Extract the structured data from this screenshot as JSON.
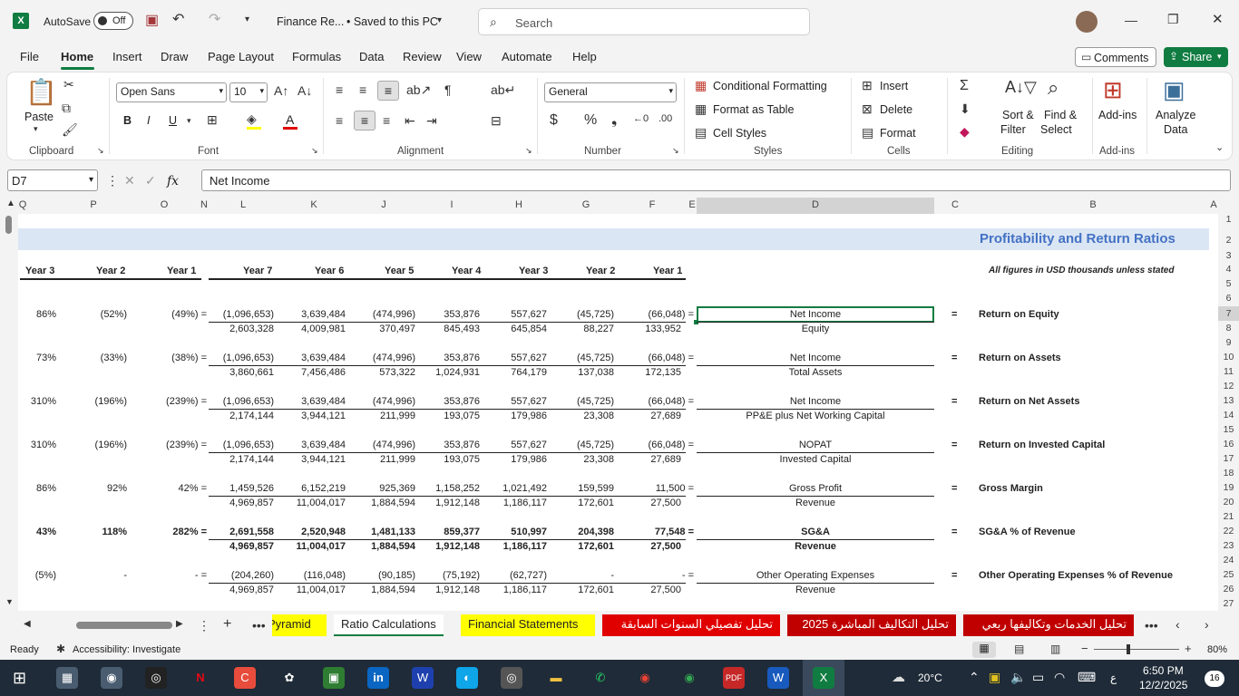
{
  "titlebar": {
    "autosave_label": "AutoSave",
    "autosave_state": "Off",
    "filename": "Finance Re...",
    "saved_status": "• Saved to this PC",
    "search_placeholder": "Search"
  },
  "menu": [
    "File",
    "Home",
    "Insert",
    "Draw",
    "Page Layout",
    "Formulas",
    "Data",
    "Review",
    "View",
    "Automate",
    "Help"
  ],
  "menu_right": {
    "comments": "Comments",
    "share": "Share"
  },
  "ribbon": {
    "clipboard": {
      "paste": "Paste",
      "label": "Clipboard"
    },
    "font": {
      "family": "Open Sans",
      "size": "10",
      "label": "Font",
      "bold": "B",
      "italic": "I",
      "underline": "U"
    },
    "alignment": {
      "label": "Alignment"
    },
    "number": {
      "format": "General",
      "label": "Number"
    },
    "styles": {
      "cond": "Conditional Formatting",
      "table": "Format as Table",
      "cell": "Cell Styles",
      "label": "Styles"
    },
    "cells": {
      "insert": "Insert",
      "delete": "Delete",
      "format": "Format",
      "label": "Cells"
    },
    "editing": {
      "sort": "Sort &",
      "sort2": "Filter",
      "find": "Find &",
      "find2": "Select",
      "label": "Editing"
    },
    "addins": {
      "btn": "Add-ins",
      "label": "Add-ins"
    },
    "analyze": {
      "btn": "Analyze",
      "btn2": "Data"
    }
  },
  "formula_bar": {
    "name_box": "D7",
    "fx": "fx",
    "content": "Net Income"
  },
  "columns": [
    "Q",
    "P",
    "O",
    "N",
    "L",
    "K",
    "J",
    "I",
    "H",
    "G",
    "F",
    "E",
    "D",
    "C",
    "B",
    "A"
  ],
  "rows": [
    "1",
    "2",
    "3",
    "4",
    "5",
    "6",
    "7",
    "8",
    "9",
    "10",
    "11",
    "12",
    "13",
    "14",
    "15",
    "16",
    "17",
    "18",
    "19",
    "20",
    "21",
    "22",
    "23",
    "24",
    "25",
    "26",
    "27"
  ],
  "sheet": {
    "title": "Profitability and Return Ratios",
    "subtitle": "All figures in USD thousands unless stated",
    "left_years": [
      "Year 3",
      "Year 2",
      "Year 1"
    ],
    "right_years": [
      "Year 7",
      "Year 6",
      "Year 5",
      "Year 4",
      "Year 3",
      "Year 2",
      "Year 1"
    ],
    "blocks": [
      {
        "pct": [
          "86%",
          "(52%)",
          "(49%) ="
        ],
        "num": [
          "(1,096,653)",
          "3,639,484",
          "(474,996)",
          "353,876",
          "557,627",
          "(45,725)",
          "(66,048) ="
        ],
        "den": [
          "2,603,328",
          "4,009,981",
          "370,497",
          "845,493",
          "645,854",
          "88,227",
          "133,952"
        ],
        "top": "Net Income",
        "bottom": "Equity",
        "name": "Return on Equity"
      },
      {
        "pct": [
          "73%",
          "(33%)",
          "(38%) ="
        ],
        "num": [
          "(1,096,653)",
          "3,639,484",
          "(474,996)",
          "353,876",
          "557,627",
          "(45,725)",
          "(66,048) ="
        ],
        "den": [
          "3,860,661",
          "7,456,486",
          "573,322",
          "1,024,931",
          "764,179",
          "137,038",
          "172,135"
        ],
        "top": "Net Income",
        "bottom": "Total Assets",
        "name": "Return on Assets"
      },
      {
        "pct": [
          "310%",
          "(196%)",
          "(239%) ="
        ],
        "num": [
          "(1,096,653)",
          "3,639,484",
          "(474,996)",
          "353,876",
          "557,627",
          "(45,725)",
          "(66,048) ="
        ],
        "den": [
          "2,174,144",
          "3,944,121",
          "211,999",
          "193,075",
          "179,986",
          "23,308",
          "27,689"
        ],
        "top": "Net Income",
        "bottom": "PP&E plus Net Working Capital",
        "name": "Return on Net Assets"
      },
      {
        "pct": [
          "310%",
          "(196%)",
          "(239%) ="
        ],
        "num": [
          "(1,096,653)",
          "3,639,484",
          "(474,996)",
          "353,876",
          "557,627",
          "(45,725)",
          "(66,048) ="
        ],
        "den": [
          "2,174,144",
          "3,944,121",
          "211,999",
          "193,075",
          "179,986",
          "23,308",
          "27,689"
        ],
        "top": "NOPAT",
        "bottom": "Invested Capital",
        "name": "Return on Invested Capital"
      },
      {
        "pct": [
          "86%",
          "92%",
          "42% ="
        ],
        "num": [
          "1,459,526",
          "6,152,219",
          "925,369",
          "1,158,252",
          "1,021,492",
          "159,599",
          "11,500 ="
        ],
        "den": [
          "4,969,857",
          "11,004,017",
          "1,884,594",
          "1,912,148",
          "1,186,117",
          "172,601",
          "27,500"
        ],
        "top": "Gross Profit",
        "bottom": "Revenue",
        "name": "Gross Margin"
      },
      {
        "pct": [
          "43%",
          "118%",
          "282% ="
        ],
        "num": [
          "2,691,558",
          "2,520,948",
          "1,481,133",
          "859,377",
          "510,997",
          "204,398",
          "77,548 ="
        ],
        "den": [
          "4,969,857",
          "11,004,017",
          "1,884,594",
          "1,912,148",
          "1,186,117",
          "172,601",
          "27,500"
        ],
        "top": "SG&A",
        "bottom": "Revenue",
        "name": "SG&A % of Revenue"
      },
      {
        "pct": [
          "(5%)",
          "-",
          "- ="
        ],
        "num": [
          "(204,260)",
          "(116,048)",
          "(90,185)",
          "(75,192)",
          "(62,727)",
          "-",
          "- ="
        ],
        "den": [
          "4,969,857",
          "11,004,017",
          "1,884,594",
          "1,912,148",
          "1,186,117",
          "172,601",
          "27,500"
        ],
        "top": "Other Operating Expenses",
        "bottom": "Revenue",
        "name": "Other Operating Expenses % of Revenue"
      }
    ]
  },
  "tabs": [
    "Pyramid",
    "Ratio Calculations",
    "Financial Statements",
    "تحليل تفصيلي السنوات السابقة",
    "تحليل التكاليف المباشرة 2025",
    "تحليل الخدمات وتكاليفها ربعي"
  ],
  "status": {
    "ready": "Ready",
    "accessibility": "Accessibility: Investigate",
    "zoom": "80%"
  },
  "taskbar": {
    "weather": "20°C",
    "time": "6:50 PM",
    "date": "12/2/2025",
    "lang": "ع",
    "notif": "16"
  },
  "colors": {
    "excel_green": "#107c41",
    "title_blue": "#4472c4",
    "band": "#dbe6f4",
    "tab_yellow": "#ffff00",
    "tab_red": "#c00000"
  }
}
